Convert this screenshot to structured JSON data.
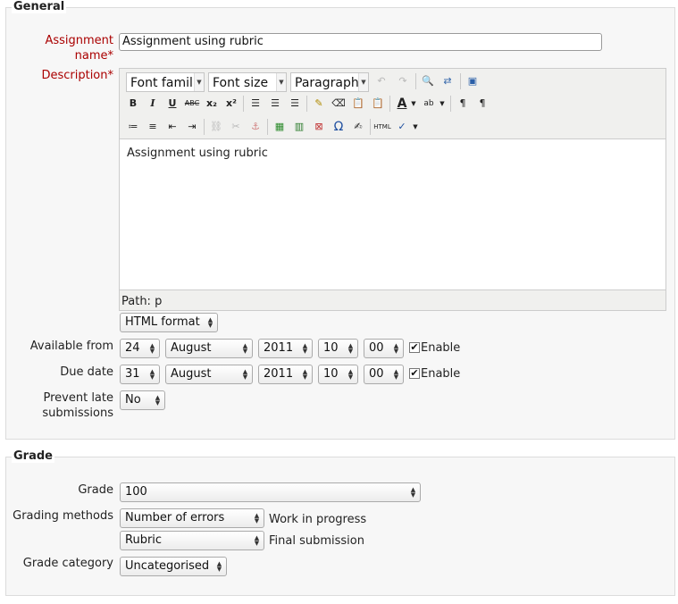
{
  "general": {
    "legend": "General",
    "assignment_name_label": "Assignment name",
    "assignment_name_value": "Assignment using rubric",
    "description_label": "Description",
    "required_mark": "*",
    "editor": {
      "font_family": "Font famil",
      "font_size": "Font size",
      "paragraph": "Paragraph",
      "content": "Assignment using rubric",
      "path": "Path: p"
    },
    "format_select": "HTML format",
    "available_from": {
      "label": "Available from",
      "day": "24",
      "month": "August",
      "year": "2011",
      "hour": "10",
      "minute": "00",
      "enable_label": "Enable"
    },
    "due_date": {
      "label": "Due date",
      "day": "31",
      "month": "August",
      "year": "2011",
      "hour": "10",
      "minute": "00",
      "enable_label": "Enable"
    },
    "prevent_late": {
      "label_line1": "Prevent late",
      "label_line2": "submissions",
      "value": "No"
    }
  },
  "grade": {
    "legend": "Grade",
    "grade_label": "Grade",
    "grade_value": "100",
    "grading_methods_label": "Grading methods",
    "method1_value": "Number of errors",
    "method1_desc": "Work in progress",
    "method2_value": "Rubric",
    "method2_desc": "Final submission",
    "grade_category_label": "Grade category",
    "grade_category_value": "Uncategorised"
  },
  "icons": {
    "check": "✔",
    "bold": "B",
    "italic": "I",
    "underline": "U",
    "strike": "ABC",
    "sub": "x₂",
    "sup": "x²",
    "omega": "Ω",
    "pilcrow": "¶",
    "html": "HTML"
  }
}
